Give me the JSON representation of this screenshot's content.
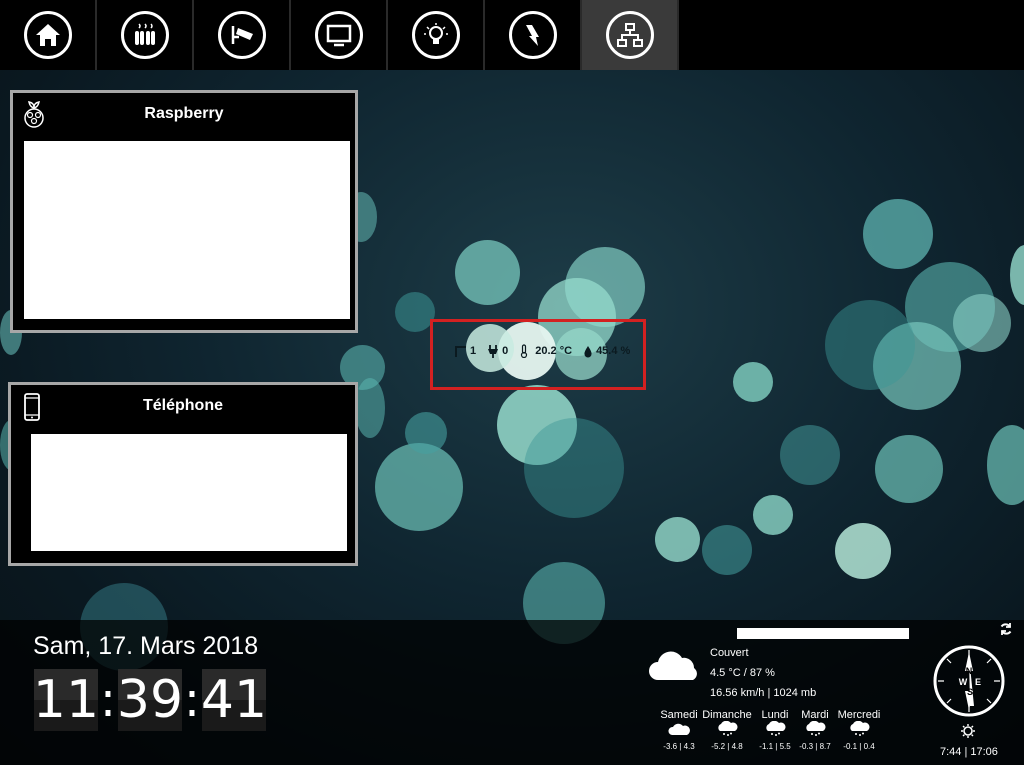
{
  "nav": {
    "items": [
      {
        "name": "home",
        "icon": "home-icon",
        "active": false
      },
      {
        "name": "heating",
        "icon": "radiator-icon",
        "active": false
      },
      {
        "name": "camera",
        "icon": "camera-icon",
        "active": false
      },
      {
        "name": "tv",
        "icon": "tv-icon",
        "active": false
      },
      {
        "name": "lighting",
        "icon": "lightbulb-icon",
        "active": false
      },
      {
        "name": "energy",
        "icon": "lightning-icon",
        "active": false
      },
      {
        "name": "network",
        "icon": "network-icon",
        "active": true
      }
    ]
  },
  "panels": {
    "raspberry": {
      "title": "Raspberry",
      "icon": "raspberry-icon"
    },
    "telephone": {
      "title": "Téléphone",
      "icon": "phone-icon"
    }
  },
  "sensors": {
    "window_count": "1",
    "plug_count": "0",
    "temperature": "20.2 °C",
    "humidity": "45.4 %"
  },
  "datetime": {
    "date": "Sam, 17. Mars 2018",
    "hours": "11",
    "minutes": "39",
    "seconds": "41"
  },
  "weather": {
    "condition": "Couvert",
    "temp_humidity": "4.5 °C / 87 %",
    "wind_pressure": "16.56 km/h | 1024 mb",
    "forecast": [
      {
        "day": "Samedi",
        "range": "-3.6 | 4.3"
      },
      {
        "day": "Dimanche",
        "range": "-5.2 | 4.8"
      },
      {
        "day": "Lundi",
        "range": "-1.1 | 5.5"
      },
      {
        "day": "Mardi",
        "range": "-0.3 | 8.7"
      },
      {
        "day": "Mercredi",
        "range": "-0.1 | 0.4"
      }
    ]
  },
  "sun": {
    "times": "7:44 | 17:06"
  },
  "compass": {
    "n": "N",
    "s": "S",
    "e": "E",
    "w": "W"
  }
}
